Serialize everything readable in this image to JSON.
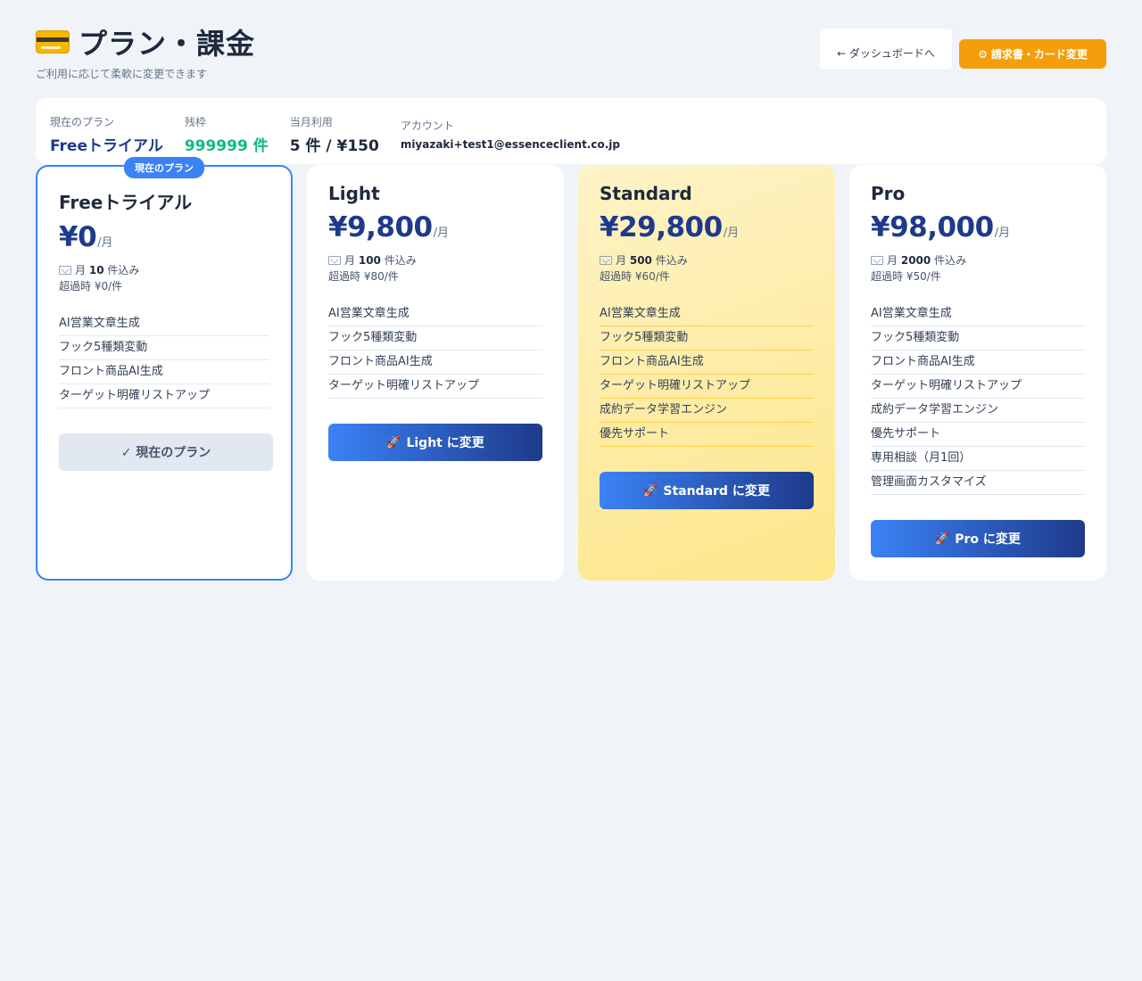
{
  "header": {
    "title": "プラン・課金",
    "icon": "credit-card-icon",
    "subtitle": "ご利用に応じて柔軟に変更できます",
    "dashboard_button": "← ダッシュボードへ",
    "billing_button": "請求書・カード変更",
    "billing_icon": "gear-icon"
  },
  "summary": {
    "current_plan_label": "現在のプラン",
    "current_plan_value": "Freeトライアル",
    "remaining_label": "残枠",
    "remaining_value": "999999 件",
    "usage_label": "当月利用",
    "usage_value": "5 件 / ¥150",
    "account_label": "アカウント",
    "account_value": "miyazaki+test1@essenceclient.co.jp"
  },
  "colors": {
    "accent_blue": "#3b82f6",
    "navy": "#1e3a8a",
    "orange": "#f59e0b",
    "green": "#10b981"
  },
  "plans": [
    {
      "name": "Freeトライアル",
      "badge": "現在のプラン",
      "price": "¥0",
      "per": "/月",
      "quota_prefix": "月",
      "quota_count": "10",
      "quota_suffix": "件込み",
      "overage": "超過時 ¥0/件",
      "features": [
        "AI営業文章生成",
        "フック5種類変動",
        "フロント商品AI生成",
        "ターゲット明確リストアップ"
      ],
      "button": "✓ 現在のプラン"
    },
    {
      "name": "Light",
      "price": "¥9,800",
      "per": "/月",
      "quota_prefix": "月",
      "quota_count": "100",
      "quota_suffix": "件込み",
      "overage": "超過時 ¥80/件",
      "features": [
        "AI営業文章生成",
        "フック5種類変動",
        "フロント商品AI生成",
        "ターゲット明確リストアップ"
      ],
      "button": "Light に変更"
    },
    {
      "name": "Standard",
      "price": "¥29,800",
      "per": "/月",
      "quota_prefix": "月",
      "quota_count": "500",
      "quota_suffix": "件込み",
      "overage": "超過時 ¥60/件",
      "features": [
        "AI営業文章生成",
        "フック5種類変動",
        "フロント商品AI生成",
        "ターゲット明確リストアップ",
        "成約データ学習エンジン",
        "優先サポート"
      ],
      "button": "Standard に変更"
    },
    {
      "name": "Pro",
      "price": "¥98,000",
      "per": "/月",
      "quota_prefix": "月",
      "quota_count": "2000",
      "quota_suffix": "件込み",
      "overage": "超過時 ¥50/件",
      "features": [
        "AI営業文章生成",
        "フック5種類変動",
        "フロント商品AI生成",
        "ターゲット明確リストアップ",
        "成約データ学習エンジン",
        "優先サポート",
        "専用相談（月1回）",
        "管理画面カスタマイズ"
      ],
      "button": "Pro に変更"
    }
  ]
}
